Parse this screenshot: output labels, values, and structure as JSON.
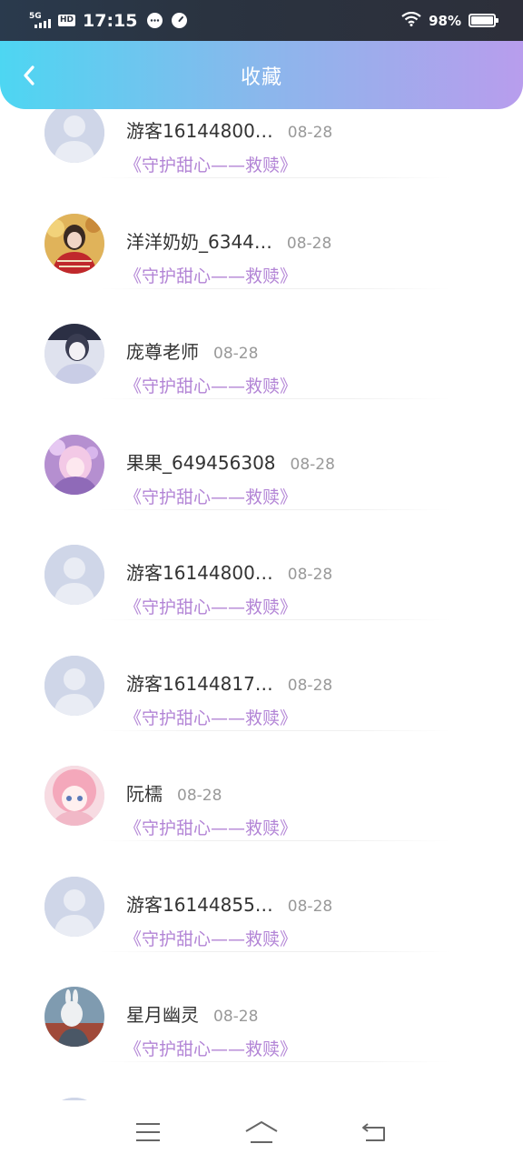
{
  "status_bar": {
    "network": "5G",
    "hd": "HD",
    "time": "17:15",
    "battery_percent": "98%",
    "battery_level": 0.98,
    "icons": [
      "signal-icon",
      "message-icon",
      "speed-icon",
      "wifi-icon",
      "battery-icon"
    ]
  },
  "header": {
    "title": "收藏",
    "back_icon": "chevron-left-icon",
    "gradient": [
      "#4dd6f2",
      "#b89ded"
    ]
  },
  "items": [
    {
      "name": "游客16144800…",
      "date": "08-28",
      "work": "《守护甜心——救赎》",
      "avatar": "default"
    },
    {
      "name": "洋洋奶奶_6344…",
      "date": "08-28",
      "work": "《守护甜心——救赎》",
      "avatar": "photo-red"
    },
    {
      "name": "庞尊老师",
      "date": "08-28",
      "work": "《守护甜心——救赎》",
      "avatar": "photo-bw"
    },
    {
      "name": "果果_649456308",
      "date": "08-28",
      "work": "《守护甜心——救赎》",
      "avatar": "anime-purple"
    },
    {
      "name": "游客16144800…",
      "date": "08-28",
      "work": "《守护甜心——救赎》",
      "avatar": "default"
    },
    {
      "name": "游客16144817…",
      "date": "08-28",
      "work": "《守护甜心——救赎》",
      "avatar": "default"
    },
    {
      "name": "阮檽",
      "date": "08-28",
      "work": "《守护甜心——救赎》",
      "avatar": "anime-pink"
    },
    {
      "name": "游客16144855…",
      "date": "08-28",
      "work": "《守护甜心——救赎》",
      "avatar": "default"
    },
    {
      "name": "星月幽灵",
      "date": "08-28",
      "work": "《守护甜心——救赎》",
      "avatar": "photo-bunny"
    }
  ],
  "colors": {
    "work_title": "#b385d6",
    "date": "#999999",
    "name": "#333333",
    "default_avatar": "#cfd6e8"
  },
  "nav": {
    "menu_icon": "menu-icon",
    "home_icon": "home-icon",
    "back_icon": "return-icon"
  }
}
